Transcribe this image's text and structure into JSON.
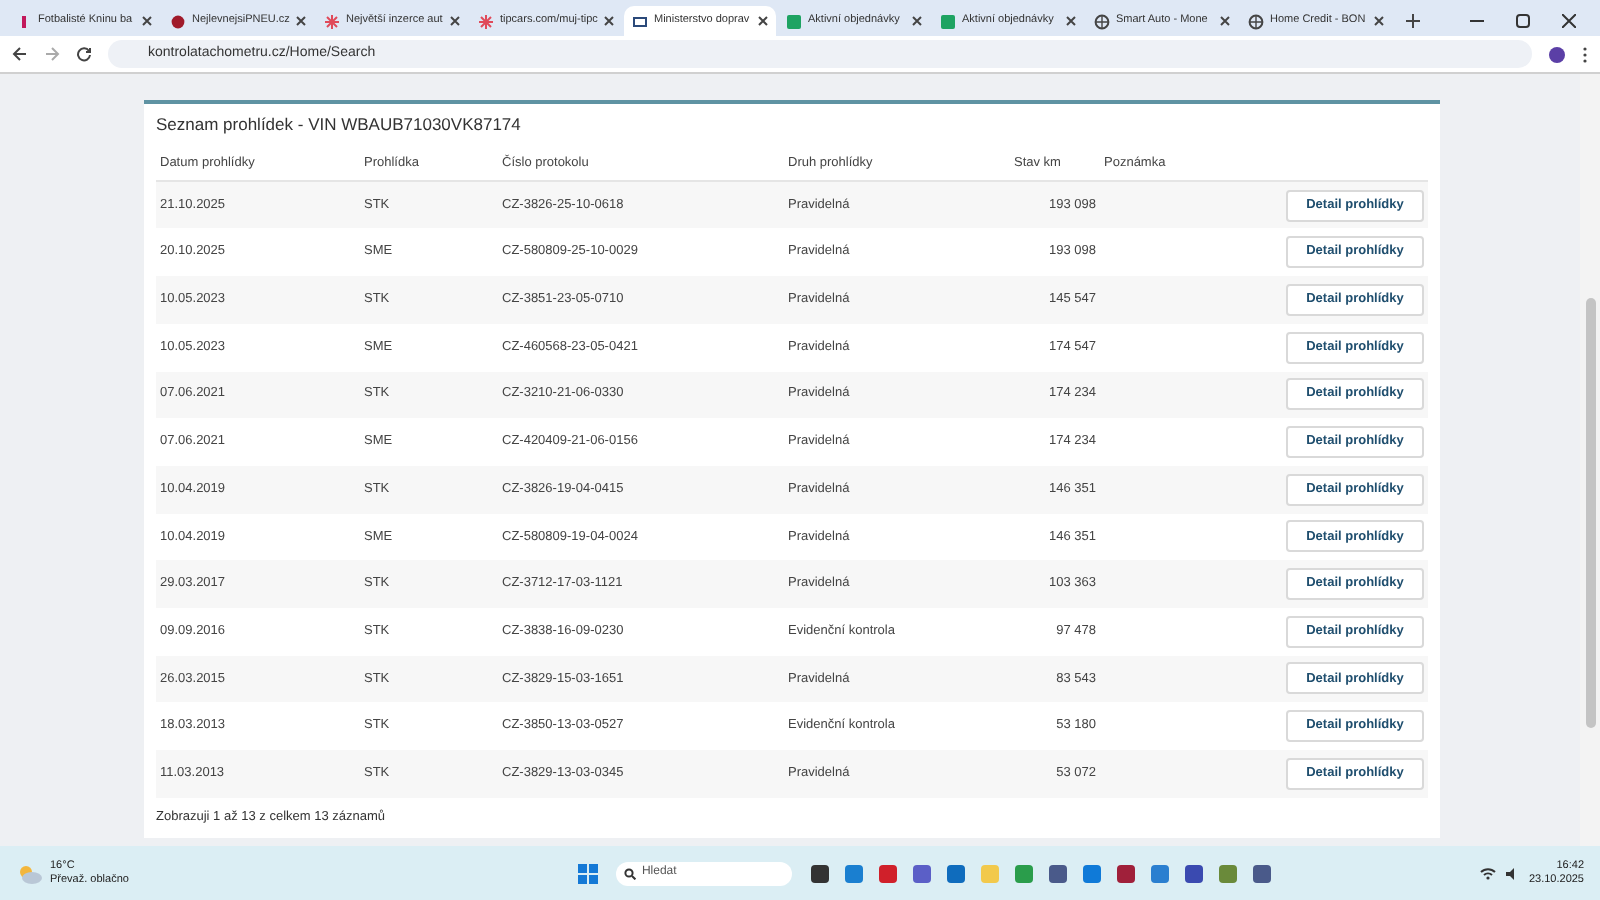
{
  "browser": {
    "tabs": [
      {
        "title": "Fotbalisté Kninu ba",
        "selected": false
      },
      {
        "title": "NejlevnejsiPNEU.cz",
        "selected": false
      },
      {
        "title": "Největší inzerce aut",
        "selected": false
      },
      {
        "title": "tipcars.com/muj-tipc",
        "selected": false
      },
      {
        "title": "Ministerstvo doprav",
        "selected": true
      },
      {
        "title": "Aktivní objednávky",
        "selected": false
      },
      {
        "title": "Aktivní objednávky",
        "selected": false
      },
      {
        "title": "Smart Auto - Mone",
        "selected": false
      },
      {
        "title": "Home Credit - BON",
        "selected": false
      }
    ],
    "address": "kontrolatachometru.cz/Home/Search"
  },
  "panel": {
    "title": "Seznam prohlídek - VIN WBAUB71030VK87174",
    "columns": [
      "Datum prohlídky",
      "Prohlídka",
      "Číslo protokolu",
      "Druh prohlídky",
      "Stav km",
      "Poznámka"
    ],
    "rows": [
      {
        "date": "21.10.2025",
        "type": "STK",
        "protocol": "CZ-3826-25-10-0618",
        "kind": "Pravidelná",
        "km": "193 098",
        "action": "Detail prohlídky"
      },
      {
        "date": "20.10.2025",
        "type": "SME",
        "protocol": "CZ-580809-25-10-0029",
        "kind": "Pravidelná",
        "km": "193 098",
        "action": "Detail prohlídky"
      },
      {
        "date": "10.05.2023",
        "type": "STK",
        "protocol": "CZ-3851-23-05-0710",
        "kind": "Pravidelná",
        "km": "145 547",
        "action": "Detail prohlídky"
      },
      {
        "date": "10.05.2023",
        "type": "SME",
        "protocol": "CZ-460568-23-05-0421",
        "kind": "Pravidelná",
        "km": "174 547",
        "action": "Detail prohlídky"
      },
      {
        "date": "07.06.2021",
        "type": "STK",
        "protocol": "CZ-3210-21-06-0330",
        "kind": "Pravidelná",
        "km": "174 234",
        "action": "Detail prohlídky"
      },
      {
        "date": "07.06.2021",
        "type": "SME",
        "protocol": "CZ-420409-21-06-0156",
        "kind": "Pravidelná",
        "km": "174 234",
        "action": "Detail prohlídky"
      },
      {
        "date": "10.04.2019",
        "type": "STK",
        "protocol": "CZ-3826-19-04-0415",
        "kind": "Pravidelná",
        "km": "146 351",
        "action": "Detail prohlídky"
      },
      {
        "date": "10.04.2019",
        "type": "SME",
        "protocol": "CZ-580809-19-04-0024",
        "kind": "Pravidelná",
        "km": "146 351",
        "action": "Detail prohlídky"
      },
      {
        "date": "29.03.2017",
        "type": "STK",
        "protocol": "CZ-3712-17-03-1121",
        "kind": "Pravidelná",
        "km": "103 363",
        "action": "Detail prohlídky"
      },
      {
        "date": "09.09.2016",
        "type": "STK",
        "protocol": "CZ-3838-16-09-0230",
        "kind": "Evidenční kontrola",
        "km": "97 478",
        "action": "Detail prohlídky"
      },
      {
        "date": "26.03.2015",
        "type": "STK",
        "protocol": "CZ-3829-15-03-1651",
        "kind": "Pravidelná",
        "km": "83 543",
        "action": "Detail prohlídky"
      },
      {
        "date": "18.03.2013",
        "type": "STK",
        "protocol": "CZ-3850-13-03-0527",
        "kind": "Evidenční kontrola",
        "km": "53 180",
        "action": "Detail prohlídky"
      },
      {
        "date": "11.03.2013",
        "type": "STK",
        "protocol": "CZ-3829-13-03-0345",
        "kind": "Pravidelná",
        "km": "53 072",
        "action": "Detail prohlídky"
      }
    ],
    "footer": "Zobrazuji 1 až 13 z celkem 13 záznamů"
  },
  "taskbar": {
    "temperature": "16°C",
    "weather": "Převaž. oblačno",
    "search_placeholder": "Hledat",
    "time": "16:42",
    "date": "23.10.2025"
  }
}
